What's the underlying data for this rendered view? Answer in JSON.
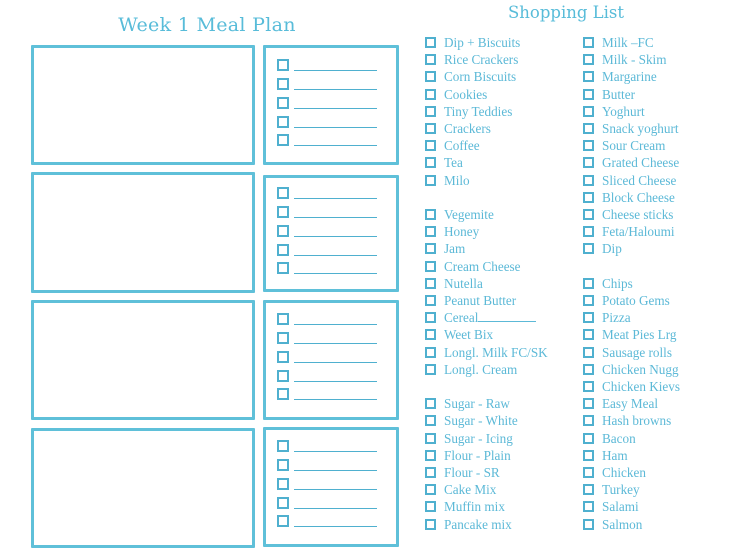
{
  "meal_plan": {
    "title": "Week 1 Meal Plan",
    "rows": [
      {
        "slots": 5
      },
      {
        "slots": 5
      },
      {
        "slots": 5
      },
      {
        "slots": 5
      }
    ]
  },
  "shopping_list": {
    "title": "Shopping List",
    "left_column": [
      "Dip + Biscuits",
      "Rice Crackers",
      "Corn Biscuits",
      "Cookies",
      "Tiny Teddies",
      "Crackers",
      "Coffee",
      "Tea",
      "Milo",
      "",
      "Vegemite",
      "Honey",
      "Jam",
      "Cream Cheese",
      "Nutella",
      "Peanut Butter",
      "Cereal",
      "Weet Bix",
      "Longl. Milk FC/SK",
      "Longl. Cream",
      "",
      "Sugar - Raw",
      "Sugar - White",
      "Sugar - Icing",
      "Flour - Plain",
      "Flour - SR",
      "Cake Mix",
      "Muffin mix",
      "Pancake mix"
    ],
    "right_column": [
      "Milk –FC",
      "Milk - Skim",
      "Margarine",
      "Butter",
      "Yoghurt",
      "Snack yoghurt",
      "Sour Cream",
      "Grated Cheese",
      "Sliced Cheese",
      "Block Cheese",
      "Cheese sticks",
      "Feta/Haloumi",
      "Dip",
      "",
      "Chips",
      "Potato Gems",
      "Pizza",
      "Meat Pies Lrg",
      "Sausage rolls",
      "Chicken Nugg",
      "Chicken Kievs",
      "Easy Meal",
      "Hash browns",
      "Bacon",
      "Ham",
      "Chicken",
      "Turkey",
      "Salami",
      "Salmon"
    ],
    "fill_in_items": [
      "Cereal"
    ]
  },
  "colors": {
    "accent": "#5fc0d9",
    "text": "#5cb9d7",
    "background": "#ffffff"
  }
}
